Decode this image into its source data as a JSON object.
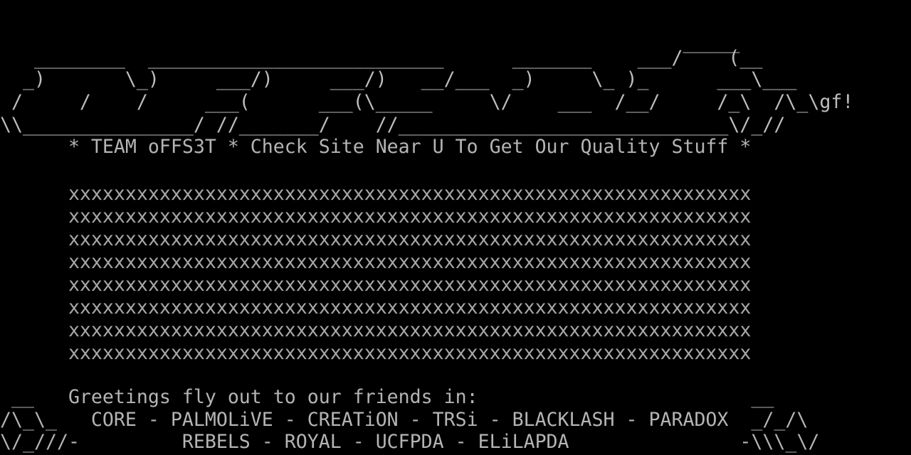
{
  "palette": {
    "background": "#000000",
    "text": "#a8a8a8",
    "logo": "#bdbdbd"
  },
  "logo": {
    "lines": [
      "                                                            _____",
      "   ________  __________________________      _______    ___/    (__",
      "  _)       \\_)     ___/)     ___/)   __/___  _)     \\_ )_      ___\\___",
      " /     /    /     ___(      ___(\\_____     \\/    ___  /__/     /_\\  /\\_\\gf!",
      "\\\\_______________/ //_______/    //_____________________________\\/_//"
    ]
  },
  "tagline": "      * TEAM oFFS3T * Check Site Near U To Get Our Quality Stuff *",
  "mask": {
    "lines": [
      "      xxxxxxxxxxxxxxxxxxxxxxxxxxxxxxxxxxxxxxxxxxxxxxxxxxxxxxxxxxxx",
      "      xxxxxxxxxxxxxxxxxxxxxxxxxxxxxxxxxxxxxxxxxxxxxxxxxxxxxxxxxxxx",
      "      xxxxxxxxxxxxxxxxxxxxxxxxxxxxxxxxxxxxxxxxxxxxxxxxxxxxxxxxxxxx",
      "      xxxxxxxxxxxxxxxxxxxxxxxxxxxxxxxxxxxxxxxxxxxxxxxxxxxxxxxxxxxx",
      "      xxxxxxxxxxxxxxxxxxxxxxxxxxxxxxxxxxxxxxxxxxxxxxxxxxxxxxxxxxxx",
      "      xxxxxxxxxxxxxxxxxxxxxxxxxxxxxxxxxxxxxxxxxxxxxxxxxxxxxxxxxxxx",
      "      xxxxxxxxxxxxxxxxxxxxxxxxxxxxxxxxxxxxxxxxxxxxxxxxxxxxxxxxxxxx",
      "      xxxxxxxxxxxxxxxxxxxxxxxxxxxxxxxxxxxxxxxxxxxxxxxxxxxxxxxxxxxx"
    ]
  },
  "greetings": {
    "lines": [
      " __   Greetings fly out to our friends in:                        __",
      "/\\_\\_   CORE - PALMOLiVE - CREATiON - TRSi - BLACKLASH - PARADOX  _/_/\\",
      "\\/_///-         REBELS - ROYAL - UCFPDA - ELiLAPDA               -\\\\\\_\\/"
    ]
  }
}
